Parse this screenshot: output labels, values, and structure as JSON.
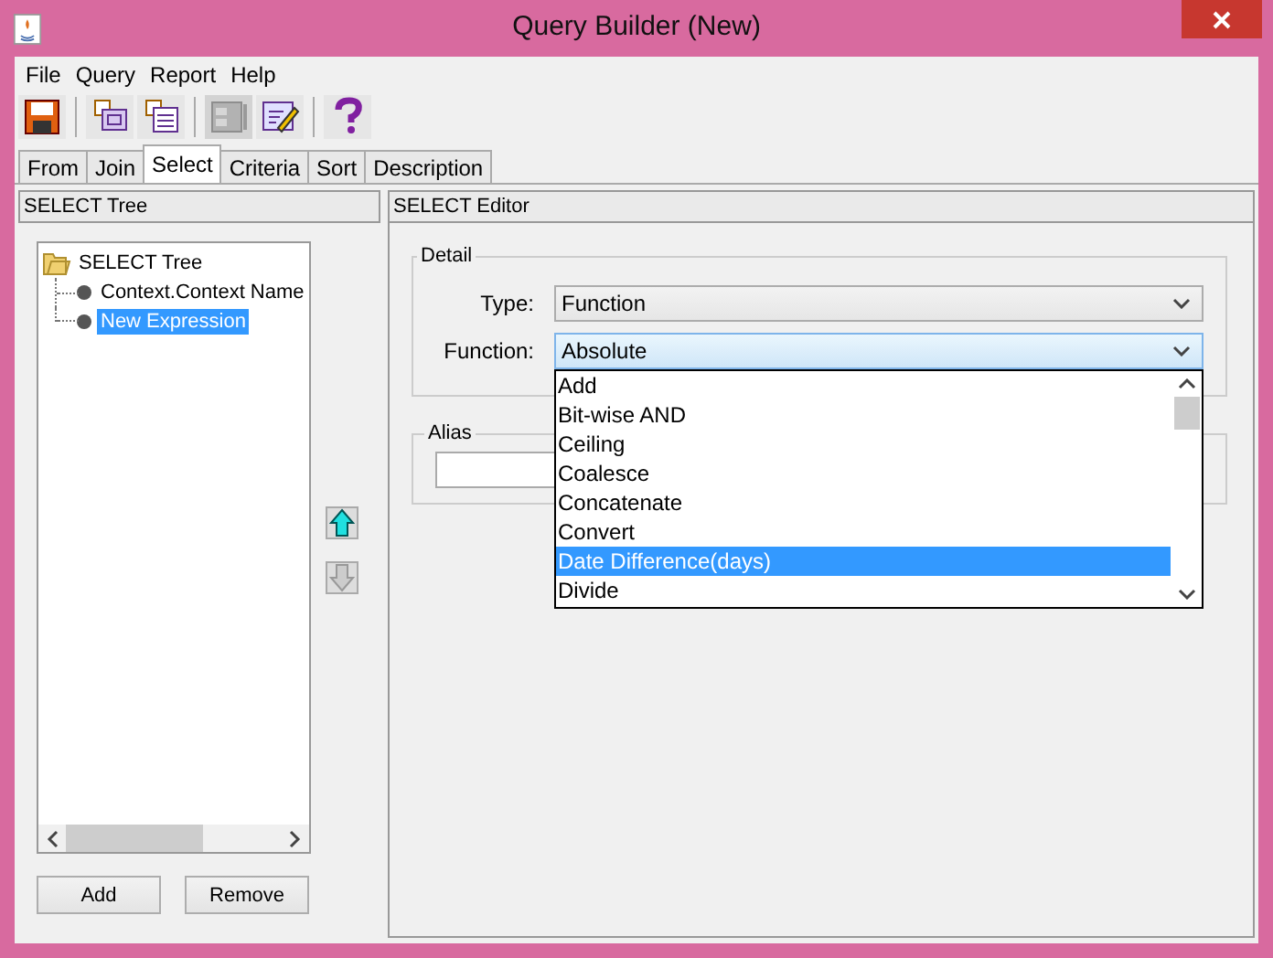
{
  "window": {
    "title": "Query Builder (New)"
  },
  "menu": [
    "File",
    "Query",
    "Report",
    "Help"
  ],
  "toolbar": [
    {
      "kind": "save",
      "disabled": false
    },
    {
      "kind": "join",
      "disabled": false
    },
    {
      "kind": "table",
      "disabled": false
    },
    {
      "kind": "form",
      "disabled": true
    },
    {
      "kind": "edit",
      "disabled": false
    },
    {
      "kind": "help",
      "disabled": false
    }
  ],
  "tabs": [
    {
      "label": "From",
      "selected": false
    },
    {
      "label": "Join",
      "selected": false
    },
    {
      "label": "Select",
      "selected": true
    },
    {
      "label": "Criteria",
      "selected": false
    },
    {
      "label": "Sort",
      "selected": false
    },
    {
      "label": "Description",
      "selected": false
    }
  ],
  "left_panel": {
    "title": "SELECT Tree",
    "tree": {
      "label": "SELECT Tree",
      "expanded": true,
      "children": [
        {
          "label": "Context.Context Name",
          "selected": false
        },
        {
          "label": "New Expression",
          "selected": true
        }
      ]
    },
    "buttons": [
      "Add",
      "Remove"
    ]
  },
  "move_buttons": [
    {
      "kind": "up",
      "disabled": false
    },
    {
      "kind": "down",
      "disabled": true
    }
  ],
  "right_panel": {
    "title": "SELECT Editor",
    "detail": {
      "title": "Detail",
      "type_label": "Type:",
      "type_value": "Function",
      "function_label": "Function:",
      "function_value": "Absolute"
    },
    "alias": {
      "title": "Alias"
    },
    "dropdown": [
      {
        "label": "Add",
        "selected": false
      },
      {
        "label": "Bit-wise AND",
        "selected": false
      },
      {
        "label": "Ceiling",
        "selected": false
      },
      {
        "label": "Coalesce",
        "selected": false
      },
      {
        "label": "Concatenate",
        "selected": false
      },
      {
        "label": "Convert",
        "selected": false
      },
      {
        "label": "Date Difference(days)",
        "selected": true
      },
      {
        "label": "Divide",
        "selected": false
      }
    ]
  }
}
